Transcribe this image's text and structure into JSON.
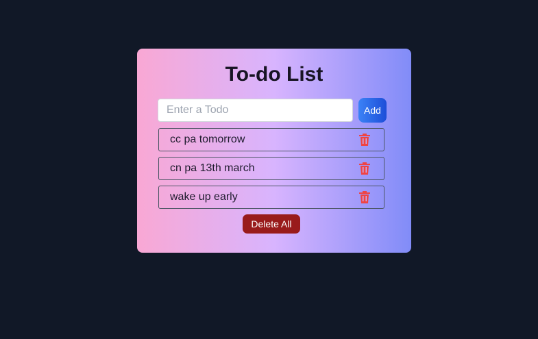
{
  "app": {
    "title": "To-do List"
  },
  "input": {
    "placeholder": "Enter a Todo",
    "value": ""
  },
  "buttons": {
    "add_label": "Add",
    "delete_all_label": "Delete All"
  },
  "todos": [
    {
      "text": "cc pa tomorrow",
      "icon": "trash-icon"
    },
    {
      "text": "cn pa 13th march",
      "icon": "trash-icon"
    },
    {
      "text": "wake up early",
      "icon": "trash-icon"
    }
  ],
  "colors": {
    "background": "#111827",
    "card_gradient": [
      "#f9a8d4",
      "#d8b4fe",
      "#818cf8"
    ],
    "add_button": "#2563eb",
    "delete_all_button": "#991b1b",
    "trash_icon": "#ef4444"
  }
}
